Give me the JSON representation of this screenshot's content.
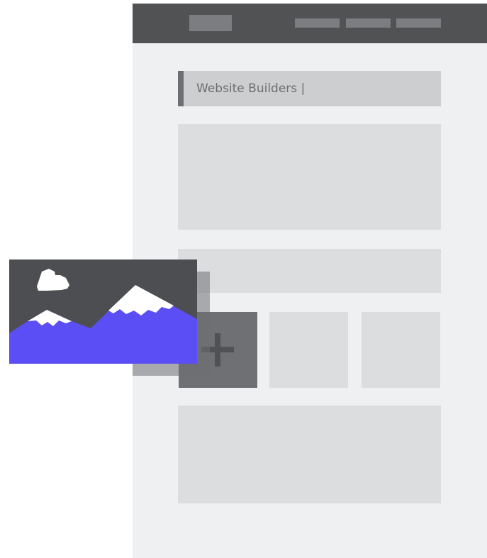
{
  "search": {
    "value": "Website Builders |"
  },
  "icons": {
    "image_card": "landscape-image-icon",
    "add_tile": "plus-icon"
  },
  "colors": {
    "header": "#515254",
    "page_background": "#eff0f2",
    "placeholder_block": "#dcdddf",
    "search_field": "#cdced0",
    "add_tile": "#6f7073",
    "image_sky": "#4d4e51",
    "image_mountains": "#5b4ef5",
    "snow_and_cloud": "#ffffff"
  }
}
